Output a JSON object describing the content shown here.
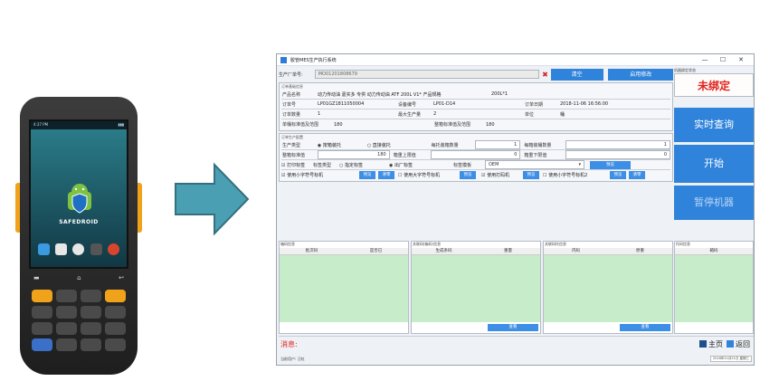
{
  "device": {
    "status_time": "4:37 PM",
    "brand": "SAFEDROID"
  },
  "window": {
    "title": "胶管MES生产执行系统",
    "minimize": "—",
    "maximize": "☐",
    "close": "✕"
  },
  "top": {
    "serial_label": "生产厂单号:",
    "serial_value": "MO01201808679",
    "clear_button": "清空",
    "enable_edit_button": "启用修改"
  },
  "order_info": {
    "section_title": "订单基础信息",
    "product_label": "产品名称",
    "product_value": "动力传动油 嘉实多 专供 动力传动油 ATF 200L V1* 产品规格",
    "spec_value": "200L*1",
    "order_no_label": "订单号",
    "order_no_value": "LP01GZ1811050004",
    "equipment_label": "设备编号",
    "equipment_value": "LP01-D14",
    "order_date_label": "订单日期",
    "order_date_value": "2018-11-06 16:56:00",
    "order_qty_label": "订单数量",
    "order_qty_value": "1",
    "max_prod_label": "最大生产量",
    "max_prod_value": "2",
    "unit_label": "单位",
    "unit_value": "桶",
    "single_std_label": "单桶标准值及范围",
    "single_std_value": "180",
    "whole_std_label": "整箱标准值及范围",
    "whole_std_value": "180"
  },
  "prod_settings": {
    "section_title": "订单生产配置",
    "type_label": "生产类型",
    "opt_pallet": "按箱装托",
    "opt_direct": "直接装托",
    "pallet_count_label": "每托装箱数量",
    "pallet_count_value": "1",
    "box_qty_label": "每箱装桶数量",
    "box_qty_value": "1",
    "box_std_label": "整箱标准值",
    "box_std_value": "180",
    "upper_label": "箱重上限值",
    "upper_value": "0",
    "lower_label": "箱重下限值",
    "lower_value": "0",
    "print_label": "打印标签",
    "label_type_label": "标签类型",
    "opt_clone": "指定标签",
    "opt_factory": "出厂标签",
    "template_label": "标签模板",
    "template_value": "OEM",
    "preview_button": "预览",
    "small_label_check": "使用小字符号标机",
    "preview2": "预览",
    "reset2": "清零",
    "big_label_check": "使用大字符号标机",
    "preview3": "预览",
    "printer_check": "使用打码机",
    "preview4": "预览",
    "small_label2_check": "使用小字符号标机2",
    "preview5": "预览",
    "reset5": "清零"
  },
  "panels": [
    {
      "title": "箱码信息",
      "cols": [
        "批次码",
        "是否已"
      ],
      "foot": ""
    },
    {
      "title": "关联码(箱码)信息",
      "cols": [
        "生成条码",
        "重量"
      ],
      "foot": "查看"
    },
    {
      "title": "关联码托信息",
      "cols": [
        "内码",
        "原重"
      ],
      "foot": "查看"
    },
    {
      "title": "托码信息",
      "cols": [
        "箱码"
      ],
      "foot": ""
    },
    {
      "title": "托码信息",
      "cols": [
        "托码"
      ],
      "foot": ""
    }
  ],
  "side": {
    "state_title": "机器绑定状态",
    "unbound": "未绑定",
    "realtime_button": "实时查询",
    "start_button": "开始",
    "stop_button": "暂停机器"
  },
  "status": {
    "message_label": "消息:",
    "home_button": "主页",
    "back_button": "返回",
    "footer_left": "当前用户: 汪虹",
    "clock_line1": "2018年11月21日",
    "clock_line2": "星期三"
  },
  "colors": {
    "accent": "#2f83db",
    "danger": "#e0231c",
    "panel_green": "#c6ecc9"
  }
}
